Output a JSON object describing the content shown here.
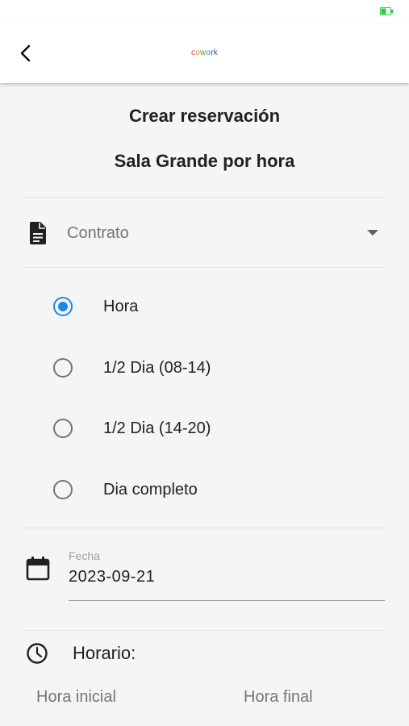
{
  "status_bar": {
    "battery_icon": "battery-charging-icon",
    "battery_color": "#2ecc40"
  },
  "appbar": {
    "back_icon": "back-arrow-icon",
    "logo_letters": [
      {
        "char": "c",
        "color": "#e53935"
      },
      {
        "char": "o",
        "color": "#fb8c00"
      },
      {
        "char": "w",
        "color": "#43a047"
      },
      {
        "char": "o",
        "color": "#1e88e5"
      },
      {
        "char": "r",
        "color": "#8e24aa"
      },
      {
        "char": "k",
        "color": "#3949ab"
      }
    ]
  },
  "form": {
    "title": "Crear reservación",
    "subtitle": "Sala Grande por hora",
    "contract": {
      "icon": "document-icon",
      "placeholder": "Contrato",
      "caret_icon": "caret-down-icon"
    },
    "options": [
      {
        "label": "Hora",
        "selected": true
      },
      {
        "label": "1/2 Dia (08-14)",
        "selected": false
      },
      {
        "label": "1/2 Dia (14-20)",
        "selected": false
      },
      {
        "label": "Dia completo",
        "selected": false
      }
    ],
    "date": {
      "icon": "calendar-icon",
      "caption": "Fecha",
      "value": "2023-09-21"
    },
    "schedule": {
      "icon": "clock-icon",
      "label": "Horario:",
      "start_label": "Hora inicial",
      "end_label": "Hora final"
    }
  },
  "colors": {
    "accent": "#1e88e5",
    "divider": "#e3e3e3",
    "background": "#f5f5f5"
  }
}
